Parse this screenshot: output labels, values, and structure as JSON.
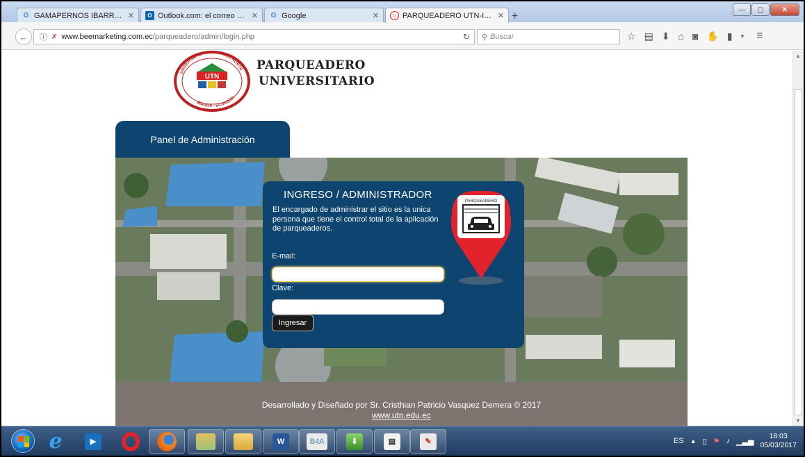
{
  "browser": {
    "tabs": [
      {
        "label": "GAMAPERNOS IBARRA - B...",
        "icon": "google-icon",
        "active": false
      },
      {
        "label": "Outlook.com: el correo per...",
        "icon": "outlook-icon",
        "active": false
      },
      {
        "label": "Google",
        "icon": "google-icon",
        "active": false
      },
      {
        "label": "PARQUEADERO UTN-IBAR...",
        "icon": "site-icon",
        "active": true
      }
    ],
    "url_domain": "www.beemarketing.com.ec",
    "url_path": "/parqueadero/admin/login.php",
    "search_placeholder": "Buscar"
  },
  "header": {
    "brand_line1": "PARQUEADERO",
    "brand_line2": "UNIVERSITARIO",
    "seal_text_top": "UNIVERSIDAD TÉCNICA DEL NORTE",
    "seal_text_bottom": "IBARRA - ECUADOR",
    "seal_letters": "UTN"
  },
  "admin_panel_tab": "Panel de Administración",
  "login": {
    "title": "INGRESO / ADMINISTRADOR",
    "description": "El encargado de administrar el sitio es la unica persona que tiene el control total de la aplicación de parqueaderos.",
    "email_label": "E-mail:",
    "password_label": "Clave:",
    "submit_label": "Ingresar",
    "pin_label": "PARQUEADERO"
  },
  "footer": {
    "credit": "Desarrollado y Diseñado por Sr. Cristhian Patricio Vasquez Demera © 2017",
    "link": "www.utn.edu.ec"
  },
  "taskbar": {
    "language": "ES",
    "time": "18:03",
    "date": "05/03/2017",
    "apps": [
      "start-button",
      "internet-explorer-icon",
      "media-center-icon",
      "opera-icon",
      "firefox-icon",
      "folder-app-icon",
      "file-explorer-icon",
      "word-icon",
      "b4a-icon",
      "download-manager-icon",
      "document-viewer-icon",
      "paint-icon"
    ],
    "b4a_label": "B4A",
    "word_label": "W"
  },
  "colors": {
    "panel_blue": "#0d4470",
    "footer_gray": "#7d7470",
    "pin_red": "#e2232b"
  }
}
